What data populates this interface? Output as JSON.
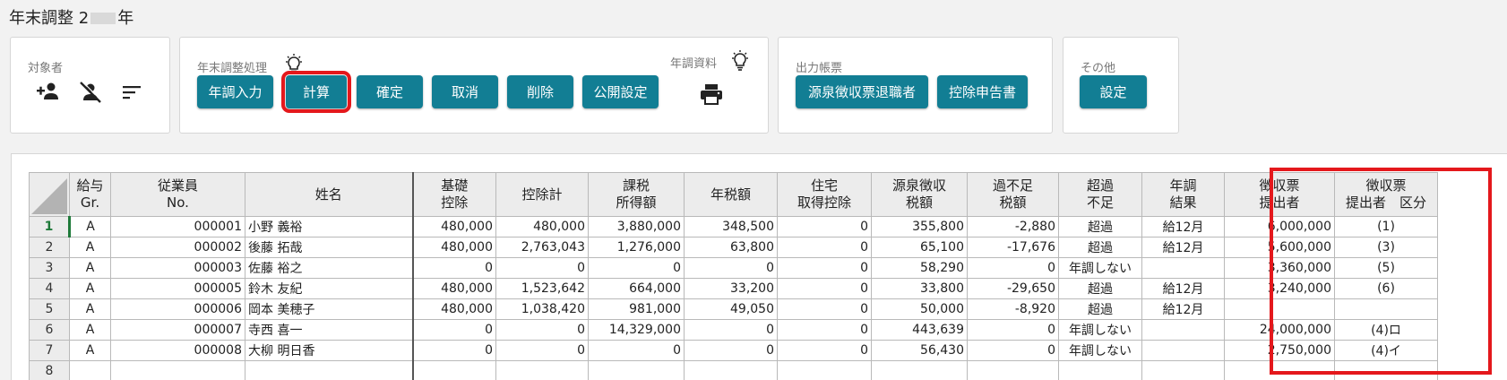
{
  "page": {
    "title_prefix": "年末調整 2",
    "title_suffix": "年"
  },
  "panels": {
    "target": {
      "label": "対象者",
      "icons": [
        "add-person-icon",
        "remove-person-icon",
        "sort-icon"
      ]
    },
    "processing": {
      "label": "年末調整処理",
      "buttons": [
        "年調入力",
        "計算",
        "確定",
        "取消",
        "削除",
        "公開設定"
      ],
      "highlighted_button": "計算"
    },
    "materials": {
      "label": "年調資料",
      "icons": [
        "print-icon"
      ]
    },
    "output": {
      "label": "出力帳票",
      "buttons": [
        "源泉徴収票退職者",
        "控除申告書"
      ]
    },
    "other": {
      "label": "その他",
      "buttons": [
        "設定"
      ]
    }
  },
  "accent_color": "#127e94",
  "highlight_color": "#e4181c",
  "table": {
    "headers": [
      "給与\nGr.",
      "従業員\nNo.",
      "姓名",
      "基礎\n控除",
      "控除計",
      "課税\n所得額",
      "年税額",
      "住宅\n取得控除",
      "源泉徴収\n税額",
      "過不足\n税額",
      "超過\n不足",
      "年調\n結果",
      "徴収票\n提出者",
      "徴収票\n提出者　区分"
    ],
    "rows": [
      {
        "no": "1",
        "gr": "A",
        "emp": "000001",
        "name": "小野 義裕",
        "kiso": "480,000",
        "kojo": "480,000",
        "kazei": "3,880,000",
        "nenzei": "348,500",
        "jutaku": "0",
        "gensen": "355,800",
        "kabusoku": "-2,880",
        "chokaf": "超過",
        "kekka": "給12月",
        "teishutsu": "6,000,000",
        "kubun": "(1)"
      },
      {
        "no": "2",
        "gr": "A",
        "emp": "000002",
        "name": "後藤 拓哉",
        "kiso": "480,000",
        "kojo": "2,763,043",
        "kazei": "1,276,000",
        "nenzei": "63,800",
        "jutaku": "0",
        "gensen": "65,100",
        "kabusoku": "-17,676",
        "chokaf": "超過",
        "kekka": "給12月",
        "teishutsu": "5,600,000",
        "kubun": "(3)"
      },
      {
        "no": "3",
        "gr": "A",
        "emp": "000003",
        "name": "佐藤 裕之",
        "kiso": "0",
        "kojo": "0",
        "kazei": "0",
        "nenzei": "0",
        "jutaku": "0",
        "gensen": "58,290",
        "kabusoku": "0",
        "chokaf": "年調しない",
        "kekka": "",
        "teishutsu": "3,360,000",
        "kubun": "(5)"
      },
      {
        "no": "4",
        "gr": "A",
        "emp": "000005",
        "name": "鈴木 友紀",
        "kiso": "480,000",
        "kojo": "1,523,642",
        "kazei": "664,000",
        "nenzei": "33,200",
        "jutaku": "0",
        "gensen": "33,800",
        "kabusoku": "-29,650",
        "chokaf": "超過",
        "kekka": "給12月",
        "teishutsu": "3,240,000",
        "kubun": "(6)"
      },
      {
        "no": "5",
        "gr": "A",
        "emp": "000006",
        "name": "岡本 美穂子",
        "kiso": "480,000",
        "kojo": "1,038,420",
        "kazei": "981,000",
        "nenzei": "49,050",
        "jutaku": "0",
        "gensen": "50,000",
        "kabusoku": "-8,920",
        "chokaf": "超過",
        "kekka": "給12月",
        "teishutsu": "",
        "kubun": ""
      },
      {
        "no": "6",
        "gr": "A",
        "emp": "000007",
        "name": "寺西 喜一",
        "kiso": "0",
        "kojo": "0",
        "kazei": "14,329,000",
        "nenzei": "0",
        "jutaku": "0",
        "gensen": "443,639",
        "kabusoku": "0",
        "chokaf": "年調しない",
        "kekka": "",
        "teishutsu": "24,000,000",
        "kubun": "(4)ロ"
      },
      {
        "no": "7",
        "gr": "A",
        "emp": "000008",
        "name": "大柳 明日香",
        "kiso": "0",
        "kojo": "0",
        "kazei": "0",
        "nenzei": "0",
        "jutaku": "0",
        "gensen": "56,430",
        "kabusoku": "0",
        "chokaf": "年調しない",
        "kekka": "",
        "teishutsu": "2,750,000",
        "kubun": "(4)イ"
      },
      {
        "no": "8",
        "gr": "",
        "emp": "",
        "name": "",
        "kiso": "",
        "kojo": "",
        "kazei": "",
        "nenzei": "",
        "jutaku": "",
        "gensen": "",
        "kabusoku": "",
        "chokaf": "",
        "kekka": "",
        "teishutsu": "",
        "kubun": ""
      }
    ]
  }
}
